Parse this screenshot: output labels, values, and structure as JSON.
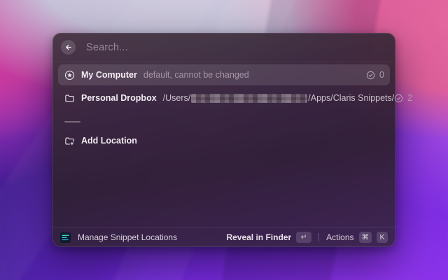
{
  "search": {
    "placeholder": "Search...",
    "back_icon": "arrow-left-icon"
  },
  "locations": [
    {
      "icon": "star-circle-icon",
      "title": "My Computer",
      "subtitle": "default, cannot be changed",
      "count": "0",
      "selected": true
    },
    {
      "icon": "folder-icon",
      "title": "Personal Dropbox",
      "path_prefix": "/Users/",
      "path_suffix": "/Apps/Claris Snippets/",
      "count": "2",
      "selected": false
    }
  ],
  "add_location": {
    "icon": "folder-plus-icon",
    "label": "Add Location"
  },
  "footer": {
    "app_icon": "snippets-app-icon",
    "title": "Manage Snippet Locations",
    "primary_action": {
      "label": "Reveal in Finder",
      "key": "↵"
    },
    "secondary_action": {
      "label": "Actions",
      "keys": [
        "⌘",
        "K"
      ]
    }
  },
  "colors": {
    "snippet_icon_teal": "#38d8c8",
    "wallpaper_magenta": "#db3f9f",
    "wallpaper_violet": "#7328df",
    "selection_highlight": "#5a4659"
  }
}
